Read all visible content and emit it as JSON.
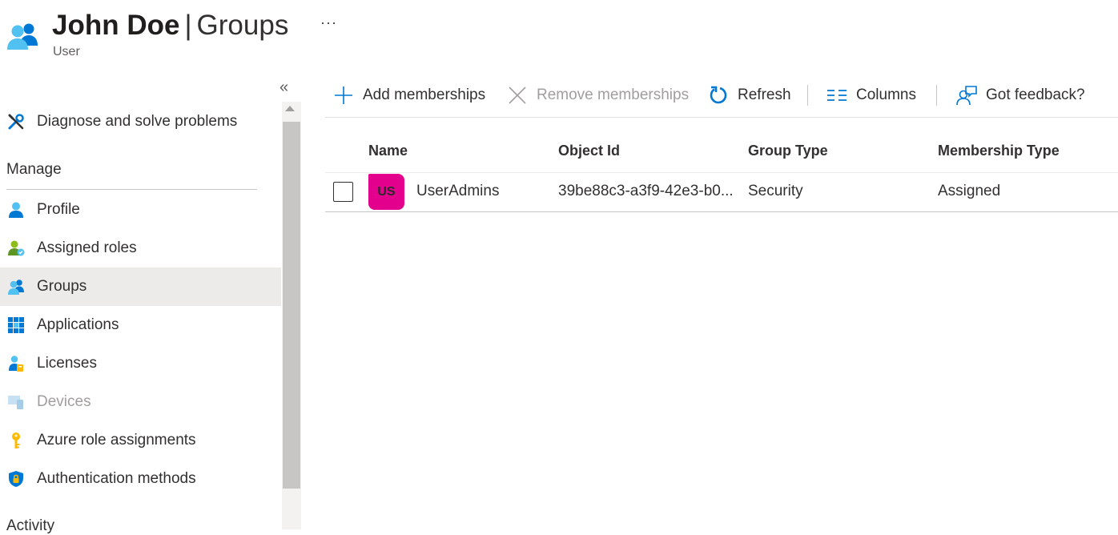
{
  "header": {
    "user_name": "John Doe",
    "separator": "|",
    "section": "Groups",
    "subtitle": "User",
    "more": "···",
    "icon": "users-group-icon"
  },
  "sidebar": {
    "collapse_label": "«",
    "diagnose": {
      "label": "Diagnose and solve problems",
      "icon": "wrench-screwdriver-icon"
    },
    "manage_label": "Manage",
    "activity_label": "Activity",
    "items": [
      {
        "label": "Profile",
        "icon": "person-icon"
      },
      {
        "label": "Assigned roles",
        "icon": "person-role-icon"
      },
      {
        "label": "Groups",
        "icon": "users-group-icon",
        "selected": true
      },
      {
        "label": "Applications",
        "icon": "apps-grid-icon"
      },
      {
        "label": "Licenses",
        "icon": "license-icon"
      },
      {
        "label": "Devices",
        "icon": "device-icon",
        "disabled": true
      },
      {
        "label": "Azure role assignments",
        "icon": "key-icon"
      },
      {
        "label": "Authentication methods",
        "icon": "shield-lock-icon"
      }
    ]
  },
  "toolbar": {
    "add": "Add memberships",
    "remove": "Remove memberships",
    "refresh": "Refresh",
    "columns": "Columns",
    "feedback": "Got feedback?"
  },
  "table": {
    "columns": [
      "Name",
      "Object Id",
      "Group Type",
      "Membership Type"
    ],
    "rows": [
      {
        "avatar_initials": "US",
        "avatar_color": "#e3008c",
        "name": "UserAdmins",
        "object_id": "39be88c3-a3f9-42e3-b0...",
        "group_type": "Security",
        "membership_type": "Assigned"
      }
    ]
  },
  "colors": {
    "accent": "#0078d4",
    "selected_bg": "#edebe9",
    "avatar": "#e3008c"
  }
}
